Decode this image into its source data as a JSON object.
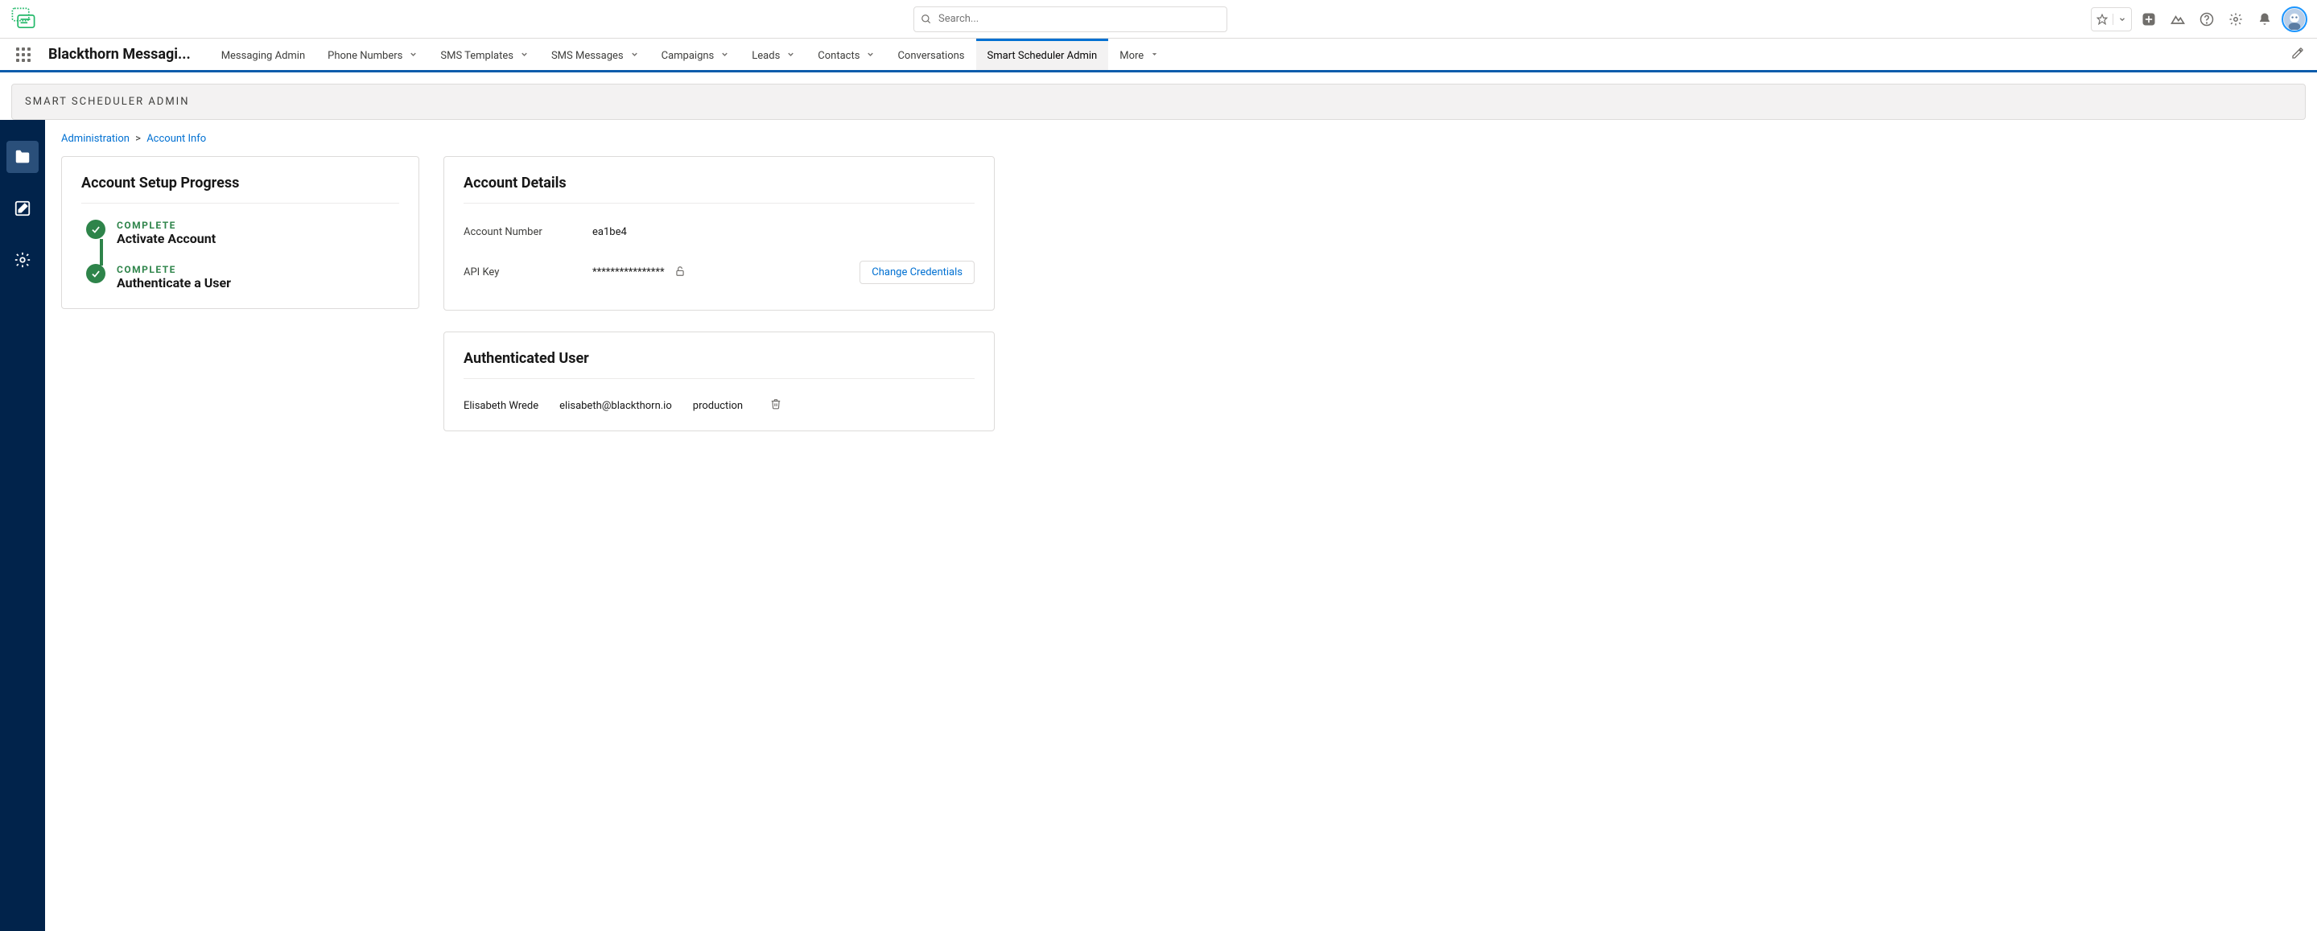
{
  "search": {
    "placeholder": "Search..."
  },
  "app_name": "Blackthorn Messagi...",
  "nav": {
    "items": [
      {
        "label": "Messaging Admin",
        "dropdown": false
      },
      {
        "label": "Phone Numbers",
        "dropdown": true
      },
      {
        "label": "SMS Templates",
        "dropdown": true
      },
      {
        "label": "SMS Messages",
        "dropdown": true
      },
      {
        "label": "Campaigns",
        "dropdown": true
      },
      {
        "label": "Leads",
        "dropdown": true
      },
      {
        "label": "Contacts",
        "dropdown": true
      },
      {
        "label": "Conversations",
        "dropdown": false
      },
      {
        "label": "Smart Scheduler Admin",
        "dropdown": false,
        "active": true
      },
      {
        "label": "More",
        "dropdown": true
      }
    ]
  },
  "page_band_title": "SMART SCHEDULER ADMIN",
  "breadcrumb": {
    "administration": "Administration",
    "account_info": "Account Info"
  },
  "progress_card": {
    "title": "Account Setup Progress",
    "steps": [
      {
        "status": "COMPLETE",
        "title": "Activate Account"
      },
      {
        "status": "COMPLETE",
        "title": "Authenticate a User"
      }
    ]
  },
  "details_card": {
    "title": "Account Details",
    "rows": {
      "account_number_label": "Account Number",
      "account_number_value": "ea1be4",
      "api_key_label": "API Key",
      "api_key_value": "****************"
    },
    "change_credentials_label": "Change Credentials"
  },
  "auth_user_card": {
    "title": "Authenticated User",
    "name": "Elisabeth Wrede",
    "email": "elisabeth@blackthorn.io",
    "env": "production"
  }
}
